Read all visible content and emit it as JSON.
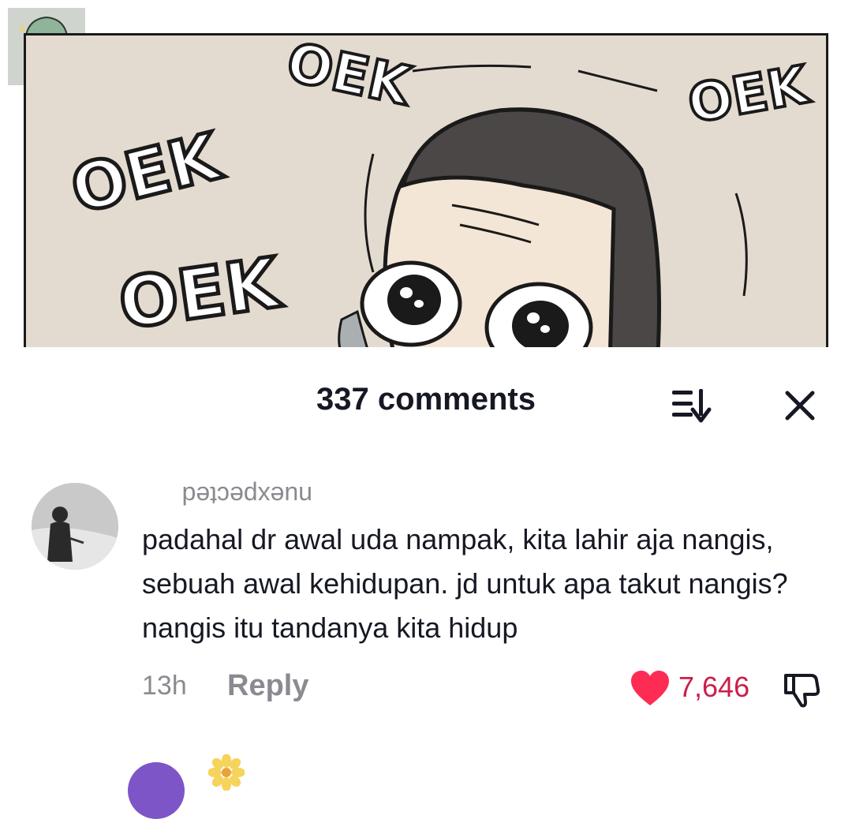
{
  "video": {
    "panel_texts": [
      "OEK",
      "OEK",
      "OEK",
      "OEK"
    ],
    "panel_colors": {
      "background": "#e4dbd0",
      "hair": "#4a4746",
      "skin": "#f3e6d6",
      "outline": "#1a1a1a"
    }
  },
  "sheet": {
    "comment_count": "337 comments",
    "sort_icon": "sort-icon",
    "close_icon": "close-icon"
  },
  "comments": [
    {
      "username": "nuexpected",
      "text": "padahal dr awal uda nampak, kita lahir aja nangis, sebuah awal kehidupan. jd untuk apa takut nangis? nangis itu tandanya kita hidup",
      "timestamp": "13h",
      "reply_label": "Reply",
      "likes": "7,646",
      "liked": true,
      "like_color": "#fe2c55"
    }
  ]
}
